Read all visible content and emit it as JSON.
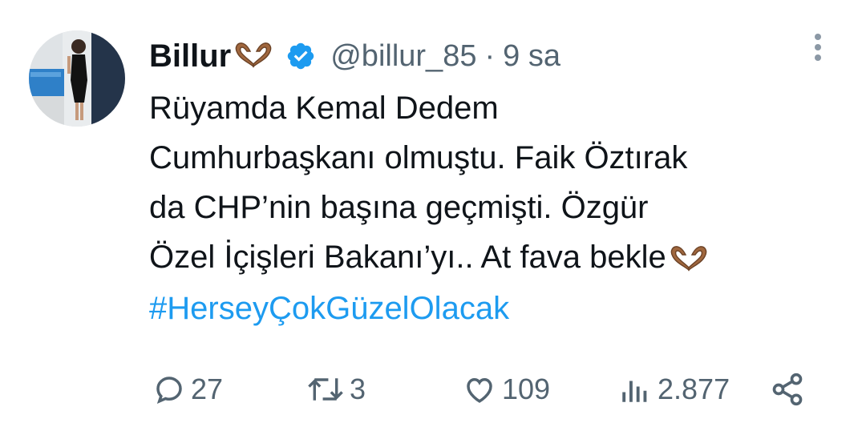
{
  "user": {
    "display_name": "Billur",
    "name_emoji": "heart-hands-emoji",
    "verified": true,
    "handle": "@billur_85",
    "separator": "·",
    "time": "9 sa"
  },
  "tweet": {
    "lines": [
      "Rüyamda Kemal Dedem",
      "Cumhurbaşkanı olmuştu. Faik Öztırak",
      "da CHP’nin başına geçmişti. Özgür",
      "Özel İçişleri Bakanı’yı.. At fava bekle"
    ],
    "trailing_emoji": "heart-hands-emoji",
    "hashtag": "#HerseyÇokGüzelOlacak"
  },
  "actions": {
    "replies": "27",
    "retweets": "3",
    "likes": "109",
    "views": "2.877"
  },
  "colors": {
    "text": "#0f1419",
    "secondary": "#536471",
    "accent": "#1d9bf0",
    "emoji_skin": "#a0673e"
  },
  "icons": [
    "more-vertical-icon",
    "verified-badge-icon",
    "reply-icon",
    "retweet-icon",
    "like-icon",
    "views-icon",
    "share-icon"
  ]
}
